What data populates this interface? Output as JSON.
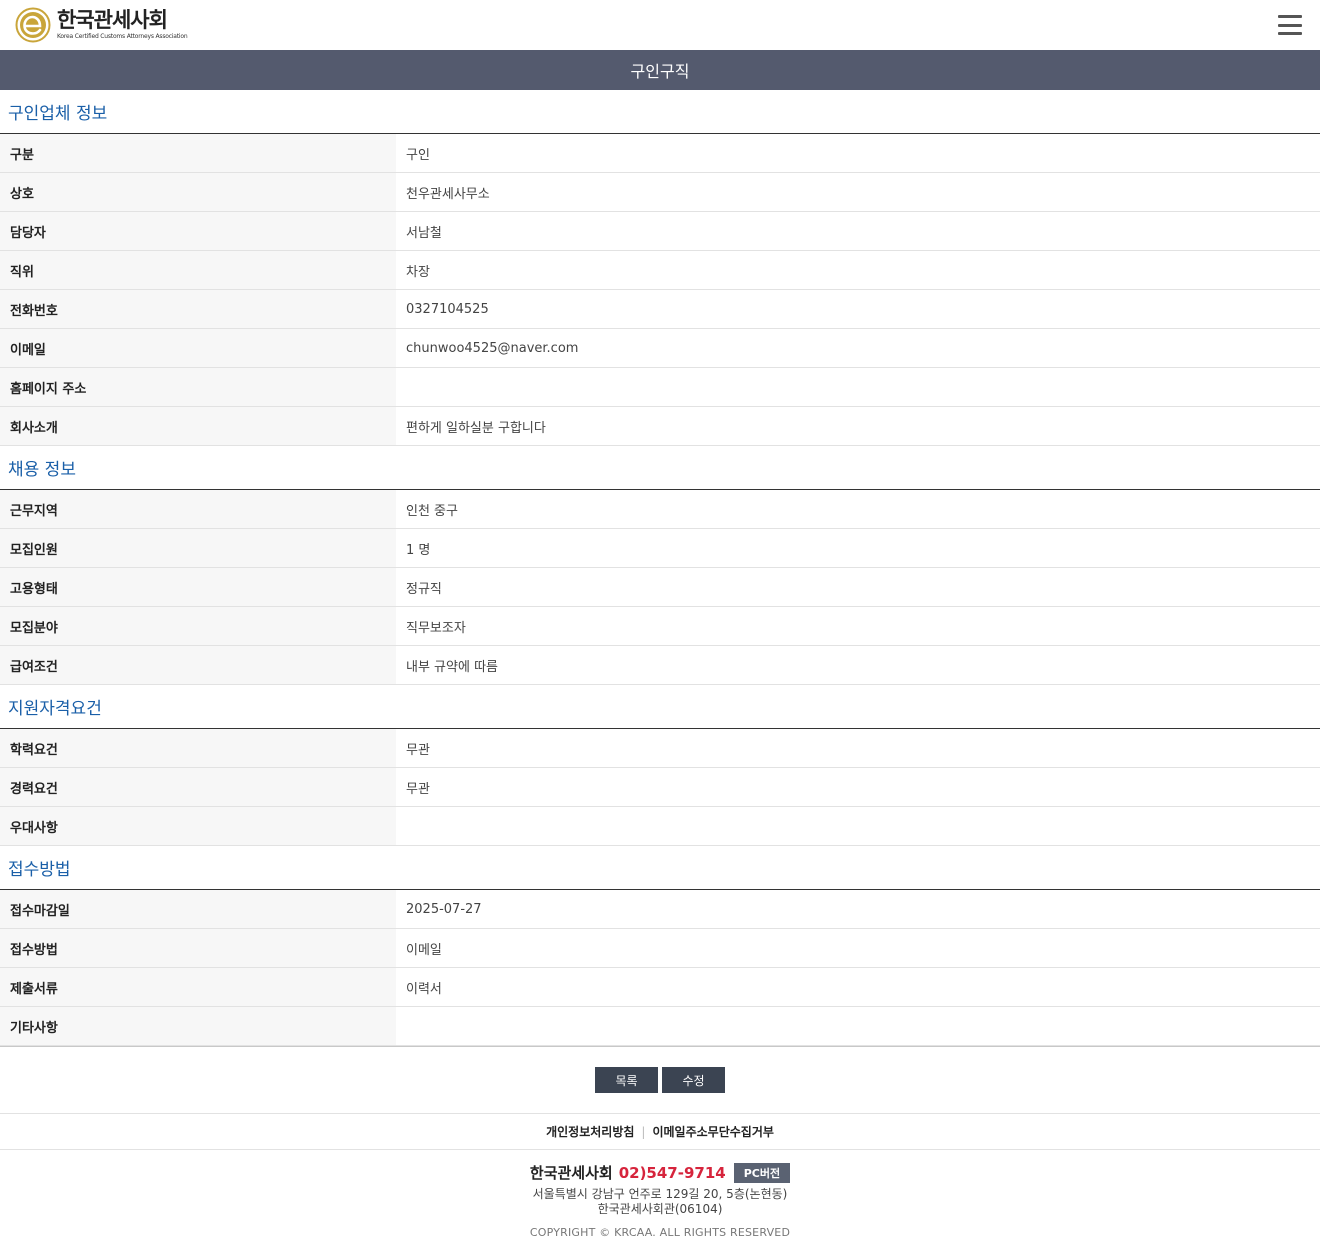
{
  "header": {
    "logo_kor": "한국관세사회",
    "logo_eng": "Korea Certified Customs Attorneys Association"
  },
  "page_title": "구인구직",
  "sections": {
    "company": {
      "title": "구인업체 정보",
      "rows": [
        {
          "label": "구분",
          "value": "구인"
        },
        {
          "label": "상호",
          "value": "천우관세사무소"
        },
        {
          "label": "담당자",
          "value": "서남철"
        },
        {
          "label": "직위",
          "value": "차장"
        },
        {
          "label": "전화번호",
          "value": "0327104525"
        },
        {
          "label": "이메일",
          "value": "chunwoo4525@naver.com"
        },
        {
          "label": "홈페이지 주소",
          "value": ""
        },
        {
          "label": "회사소개",
          "value": "편하게 일하실분 구합니다"
        }
      ]
    },
    "recruit": {
      "title": "채용 정보",
      "rows": [
        {
          "label": "근무지역",
          "value": "인천 중구"
        },
        {
          "label": "모집인원",
          "value": "1 명"
        },
        {
          "label": "고용형태",
          "value": "정규직"
        },
        {
          "label": "모집분야",
          "value": "직무보조자"
        },
        {
          "label": "급여조건",
          "value": "내부 규약에 따름"
        }
      ]
    },
    "qualification": {
      "title": "지원자격요건",
      "rows": [
        {
          "label": "학력요건",
          "value": "무관"
        },
        {
          "label": "경력요건",
          "value": "무관"
        },
        {
          "label": "우대사항",
          "value": ""
        }
      ]
    },
    "apply": {
      "title": "접수방법",
      "rows": [
        {
          "label": "접수마감일",
          "value": "2025-07-27"
        },
        {
          "label": "접수방법",
          "value": "이메일"
        },
        {
          "label": "제출서류",
          "value": "이력서"
        },
        {
          "label": "기타사항",
          "value": ""
        }
      ]
    }
  },
  "buttons": {
    "list": "목록",
    "edit": "수정"
  },
  "policy": {
    "privacy": "개인정보처리방침",
    "email_refuse": "이메일주소무단수집거부"
  },
  "footer": {
    "name": "한국관세사회",
    "phone": "02)547-9714",
    "pc_version": "PC버전",
    "address_line1": "서울특별시 강남구 언주로 129길 20, 5층(논현동)",
    "address_line2": "한국관세사회관(06104)",
    "copyright": "COPYRIGHT © KRCAA. ALL RIGHTS RESERVED"
  },
  "colors": {
    "title_bar": "#545a6e",
    "section_title": "#1a5fa8",
    "button": "#3b4452",
    "phone": "#d6243c",
    "logo_gold": "#c9a53a"
  }
}
